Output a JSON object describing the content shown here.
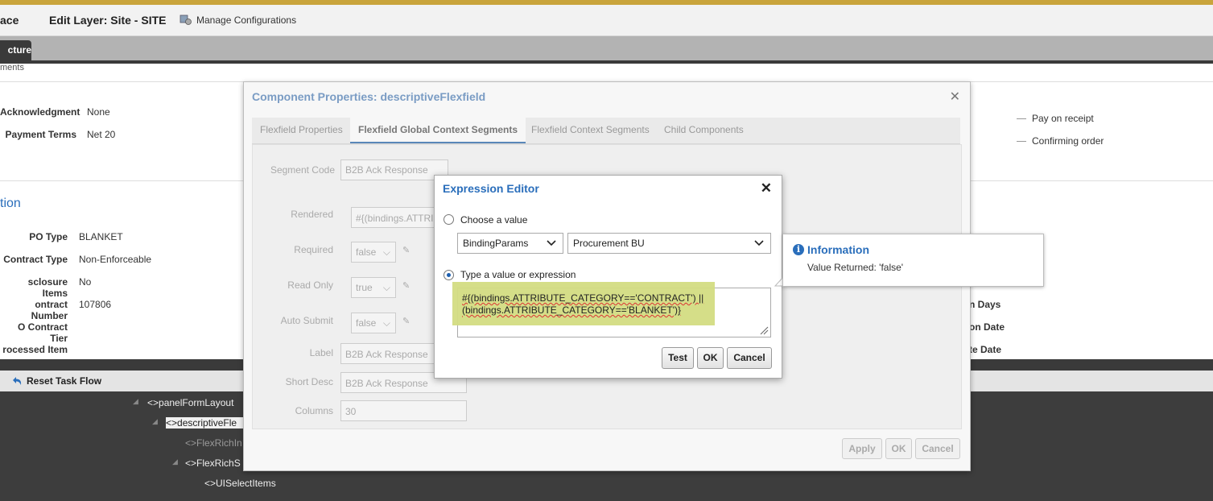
{
  "header": {
    "left_title": "ace",
    "edit_layer": "Edit Layer: Site - SITE",
    "manage_config": "Manage Configurations"
  },
  "structure_tab": "cture",
  "subheader_text": "ments",
  "background_fields": {
    "left": [
      {
        "label": "Acknowledgment",
        "value": "None"
      },
      {
        "label": "Payment Terms",
        "value": "Net 20"
      }
    ],
    "right": [
      "Pay on receipt",
      "Confirming order"
    ],
    "section_title": "tion",
    "details": [
      {
        "label": "PO Type",
        "value": "BLANKET"
      },
      {
        "label": "Contract Type",
        "value": "Non-Enforceable"
      },
      {
        "label": "sclosure Items",
        "value": "No"
      },
      {
        "label": "ontract Number",
        "value": "107806"
      },
      {
        "label": "O Contract Tier",
        "value": ""
      },
      {
        "label": "rocessed Item",
        "value": ""
      }
    ],
    "right_details": [
      "n Days",
      "on Date",
      "te Date"
    ]
  },
  "reset_task_flow": "Reset Task Flow",
  "tree": [
    {
      "label": "<>panelFormLayout",
      "dim": false
    },
    {
      "label": "<>descriptiveFle",
      "dim": false
    },
    {
      "label": "<>FlexRichIn",
      "dim": true
    },
    {
      "label": "<>FlexRichS",
      "dim": false
    },
    {
      "label": "<>UISelectItems",
      "dim": false
    }
  ],
  "component_dialog": {
    "title": "Component Properties: descriptiveFlexfield",
    "tabs": [
      "Flexfield Properties",
      "Flexfield Global Context Segments",
      "Flexfield Context Segments",
      "Child Components"
    ],
    "active_tab": 1,
    "segment_code_label": "Segment Code",
    "segment_code_value": "B2B Ack Response",
    "rows": [
      {
        "label": "Rendered",
        "value": "#{(bindings.ATTRI"
      },
      {
        "label": "Required",
        "value": "false"
      },
      {
        "label": "Read Only",
        "value": "true"
      },
      {
        "label": "Auto Submit",
        "value": "false"
      },
      {
        "label": "Label",
        "value": "B2B Ack Response"
      },
      {
        "label": "Short Desc",
        "value": "B2B Ack Response"
      },
      {
        "label": "Columns",
        "value": "30"
      }
    ],
    "buttons": {
      "apply": "Apply",
      "ok": "OK",
      "cancel": "Cancel"
    }
  },
  "expression_editor": {
    "title": "Expression Editor",
    "choose_value_label": "Choose a value",
    "binding_select": "BindingParams",
    "procurement_select": "Procurement BU",
    "type_value_label": "Type a value or expression",
    "expression_line1": "#{(bindings.ATTRIBUTE_CATEGORY=='CONTRACT') ||",
    "expression_line2": "(bindings.ATTRIBUTE_CATEGORY=='BLANKET')}",
    "buttons": {
      "test": "Test",
      "ok": "OK",
      "cancel": "Cancel"
    },
    "selected_option": "type"
  },
  "info_popup": {
    "title": "Information",
    "text": "Value Returned: 'false'"
  }
}
